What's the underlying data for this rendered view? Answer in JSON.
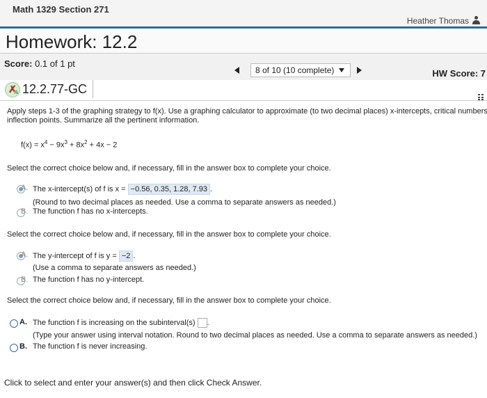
{
  "course": {
    "title": "Math 1329 Section 271"
  },
  "user": {
    "name": "Heather Thomas"
  },
  "homework": {
    "title": "Homework: 12.2"
  },
  "score": {
    "label": "Score:",
    "value": "0.1 of 1 pt"
  },
  "nav": {
    "progress": "8 of 10 (10 complete)"
  },
  "hw_score": {
    "label": "HW Score: 7"
  },
  "question": {
    "id": "12.2.77-GC"
  },
  "instructions": {
    "line1": "Apply steps 1-3 of the graphing strategy to f(x). Use a graphing calculator to approximate (to two decimal places) x-intercepts, critical numbers",
    "line2": "inflection points. Summarize all the pertinent information."
  },
  "function": {
    "lhs": "f(x) = x",
    "exp1": "4",
    "t2": " − 9x",
    "exp2": "3",
    "t3": " + 8x",
    "exp3": "2",
    "t4": " + 4x − 2"
  },
  "part1": {
    "prompt": "Select the correct choice below and, if necessary, fill in the answer box to complete your choice.",
    "a_letter": "A.",
    "a_text": "The x-intercept(s) of f is x =",
    "a_answer": "−0.56, 0.35, 1.28, 7.93",
    "a_note": "(Round to two decimal places as needed. Use a comma to separate answers as needed.)",
    "b_letter": "B.",
    "b_text": "The function f has no x-intercepts."
  },
  "part2": {
    "prompt": "Select the correct choice below and, if necessary, fill in the answer box to complete your choice.",
    "a_letter": "A.",
    "a_text": "The y-intercept of f is y =",
    "a_answer": "−2",
    "a_note": "(Use a comma to separate answers as needed.)",
    "b_letter": "B.",
    "b_text": "The function f has no y-intercept."
  },
  "part3": {
    "prompt": "Select the correct choice below and, if necessary, fill in the answer box to complete your choice.",
    "a_letter": "A.",
    "a_text": "The function f is increasing on the subinterval(s)",
    "a_note": "(Type your answer using interval notation. Round to two decimal places as needed. Use a comma to separate answers as needed.)",
    "b_letter": "B.",
    "b_text": "The function f is never increasing."
  },
  "footer": {
    "text": "Click to select and enter your answer(s) and then click Check Answer."
  },
  "colors": {
    "accent": "#2f6b9a",
    "answer_bg": "#dfe9f3"
  },
  "icons": {
    "user": "user-icon",
    "question_status": "partial-credit-icon",
    "menu": "grid-menu-icon"
  }
}
